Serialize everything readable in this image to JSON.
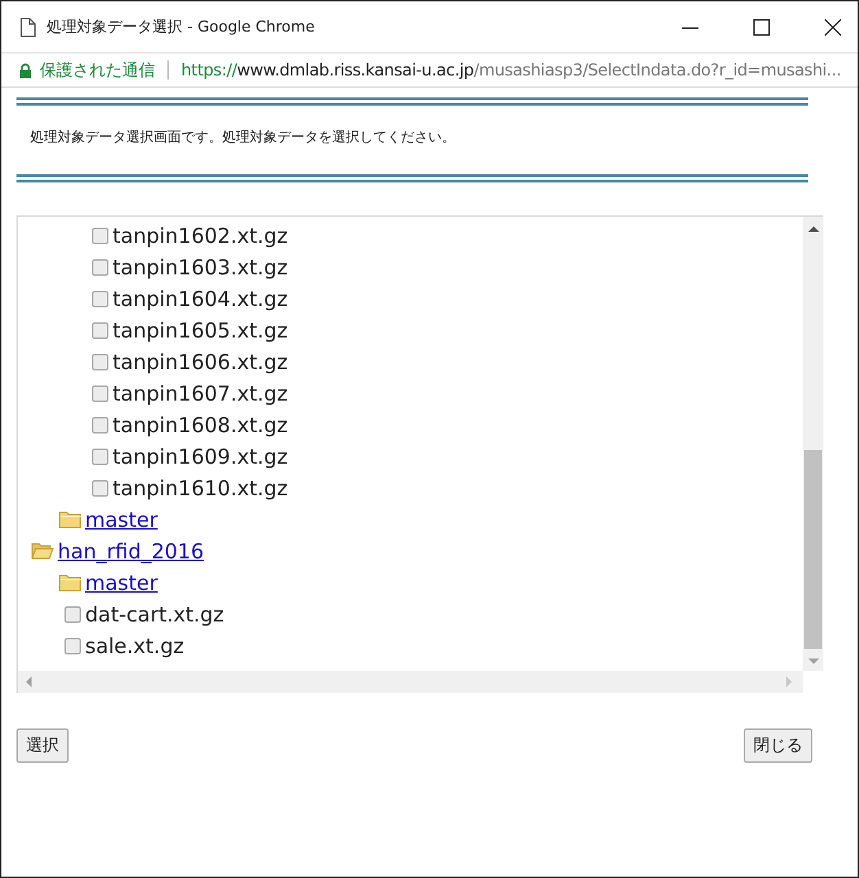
{
  "window": {
    "title": "処理対象データ選択 - Google Chrome"
  },
  "address_bar": {
    "security": "保護された通信",
    "url_scheme": "https://",
    "url_host": "www.dmlab.riss.kansai-u.ac.jp",
    "url_path": "/musashiasp3/SelectIndata.do?r_id=musashi..."
  },
  "instruction": "処理対象データ選択画面です。処理対象データを選択してください。",
  "tree": [
    {
      "kind": "group",
      "children": [
        {
          "kind": "group",
          "children": [
            {
              "kind": "file",
              "label": "tanpin1602.xt.gz",
              "checked": false
            },
            {
              "kind": "file",
              "label": "tanpin1603.xt.gz",
              "checked": false
            },
            {
              "kind": "file",
              "label": "tanpin1604.xt.gz",
              "checked": false
            },
            {
              "kind": "file",
              "label": "tanpin1605.xt.gz",
              "checked": false
            },
            {
              "kind": "file",
              "label": "tanpin1606.xt.gz",
              "checked": false
            },
            {
              "kind": "file",
              "label": "tanpin1607.xt.gz",
              "checked": false
            },
            {
              "kind": "file",
              "label": "tanpin1608.xt.gz",
              "checked": false
            },
            {
              "kind": "file",
              "label": "tanpin1609.xt.gz",
              "checked": false
            },
            {
              "kind": "file",
              "label": "tanpin1610.xt.gz",
              "checked": false
            }
          ]
        },
        {
          "kind": "folder",
          "label": "master",
          "expanded": false
        }
      ]
    },
    {
      "kind": "folder",
      "label": "han_rfid_2016",
      "expanded": true,
      "children": [
        {
          "kind": "folder",
          "label": "master",
          "expanded": false
        },
        {
          "kind": "file",
          "label": "dat-cart.xt.gz",
          "checked": false
        },
        {
          "kind": "file",
          "label": "sale.xt.gz",
          "checked": false
        }
      ]
    }
  ],
  "buttons": {
    "select": "選択",
    "close": "閉じる"
  }
}
